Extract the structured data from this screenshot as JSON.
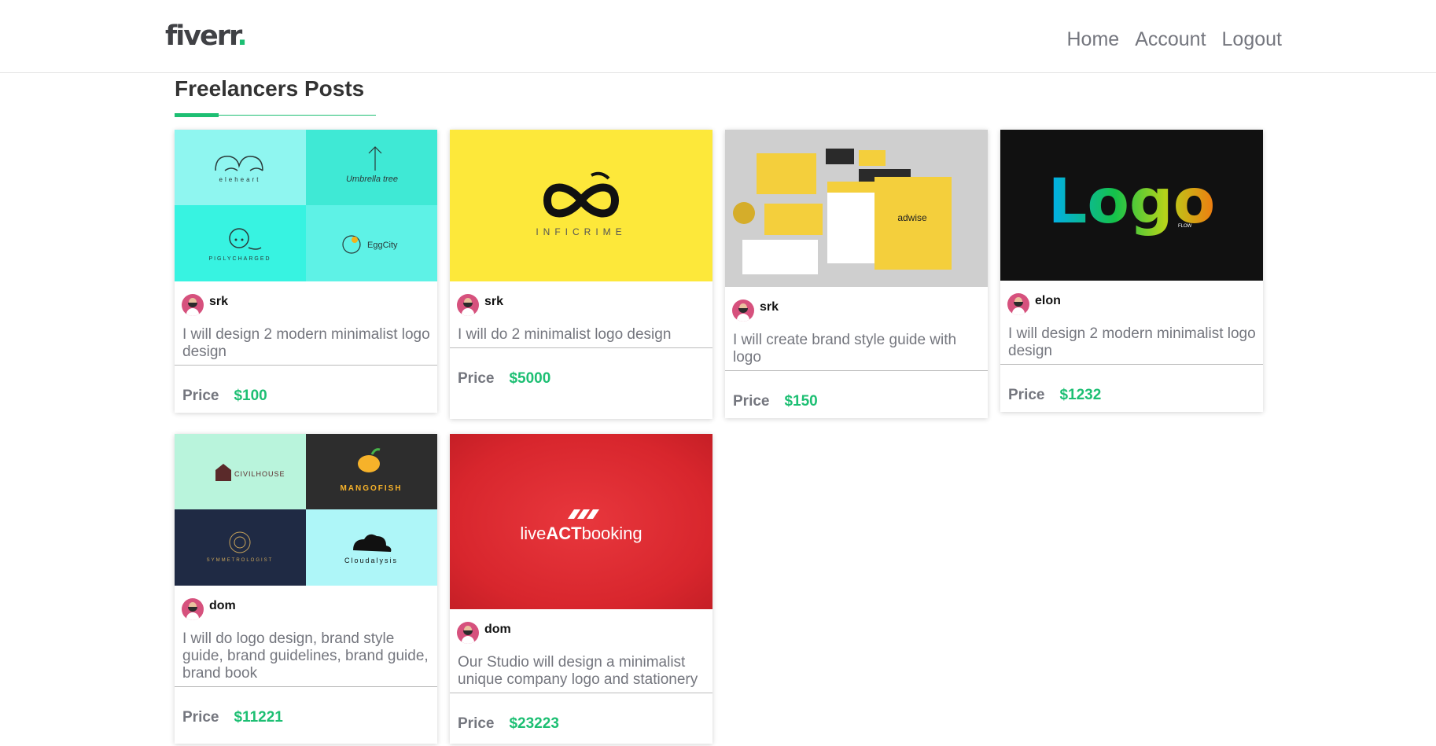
{
  "header": {
    "logo_text": "fiverr",
    "logo_dot": ".",
    "nav": [
      "Home",
      "Account",
      "Logout"
    ]
  },
  "section": {
    "title": "Freelancers Posts"
  },
  "price_label": "Price",
  "posts": [
    {
      "user": "srk",
      "description": "I will design 2 modern minimalist logo design",
      "price": "$100",
      "image_text": [
        "eleheart",
        "Umbrella tree",
        "PIGLYCHARGED",
        "EggCity"
      ]
    },
    {
      "user": "srk",
      "description": "I will do 2 minimalist logo design",
      "price": "$5000",
      "image_text": [
        "INFICRIME"
      ]
    },
    {
      "user": "srk",
      "description": "I will create brand style guide with logo",
      "price": "$150",
      "image_text": [
        "adwise"
      ]
    },
    {
      "user": "elon",
      "description": "I will design 2 modern minimalist logo design",
      "price": "$1232",
      "image_text": [
        "Logo",
        "FLOW"
      ]
    },
    {
      "user": "dom",
      "description": "I will do logo design, brand style guide, brand guidelines, brand guide, brand book",
      "price": "$11221",
      "image_text": [
        "CIVILHOUSE",
        "MANGOFISH",
        "SYMMETROLOGIST",
        "Cloudalysis"
      ]
    },
    {
      "user": "dom",
      "description": "Our Studio will design a minimalist unique company logo and stationery",
      "price": "$23223",
      "image_text": [
        "live",
        "ACT",
        "booking"
      ]
    }
  ],
  "colors": {
    "accent": "#1dbf73",
    "muted": "#74767e"
  }
}
